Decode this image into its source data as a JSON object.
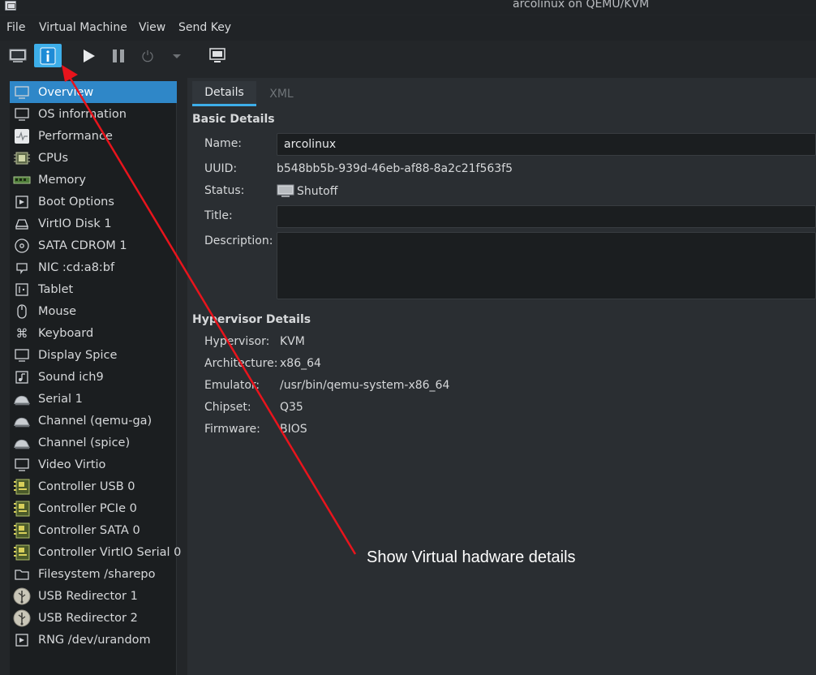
{
  "window": {
    "title": "arcolinux on QEMU/KVM"
  },
  "menu": [
    "File",
    "Virtual Machine",
    "View",
    "Send Key"
  ],
  "toolbar": [
    {
      "name": "console",
      "icon": "monitor-icon",
      "active": false
    },
    {
      "name": "details",
      "icon": "info-icon",
      "active": true
    },
    {
      "name": "run",
      "icon": "play-icon",
      "active": false
    },
    {
      "name": "pause",
      "icon": "pause-icon",
      "active": false
    },
    {
      "name": "shutdown",
      "icon": "power-icon",
      "active": false,
      "disabled": true
    },
    {
      "name": "shutdown-menu",
      "icon": "chevron-down-icon",
      "active": false,
      "disabled": true
    },
    {
      "name": "fullscreen",
      "icon": "fullscreen-icon",
      "active": false
    }
  ],
  "sidebar": {
    "items": [
      {
        "label": "Overview",
        "icon": "display-icon",
        "selected": true
      },
      {
        "label": "OS information",
        "icon": "display-icon"
      },
      {
        "label": "Performance",
        "icon": "performance-icon"
      },
      {
        "label": "CPUs",
        "icon": "cpu-icon"
      },
      {
        "label": "Memory",
        "icon": "memory-icon"
      },
      {
        "label": "Boot Options",
        "icon": "boot-icon"
      },
      {
        "label": "VirtIO Disk 1",
        "icon": "disk-icon"
      },
      {
        "label": "SATA CDROM 1",
        "icon": "cdrom-icon"
      },
      {
        "label": "NIC :cd:a8:bf",
        "icon": "nic-icon"
      },
      {
        "label": "Tablet",
        "icon": "tablet-icon"
      },
      {
        "label": "Mouse",
        "icon": "mouse-icon"
      },
      {
        "label": "Keyboard",
        "icon": "keyboard-icon"
      },
      {
        "label": "Display Spice",
        "icon": "display-icon"
      },
      {
        "label": "Sound ich9",
        "icon": "sound-icon"
      },
      {
        "label": "Serial 1",
        "icon": "serial-icon"
      },
      {
        "label": "Channel (qemu-ga)",
        "icon": "serial-icon"
      },
      {
        "label": "Channel (spice)",
        "icon": "serial-icon"
      },
      {
        "label": "Video Virtio",
        "icon": "display-icon"
      },
      {
        "label": "Controller USB 0",
        "icon": "controller-icon"
      },
      {
        "label": "Controller PCIe 0",
        "icon": "controller-icon"
      },
      {
        "label": "Controller SATA 0",
        "icon": "controller-icon"
      },
      {
        "label": "Controller VirtIO Serial 0",
        "icon": "controller-icon"
      },
      {
        "label": "Filesystem /sharepo",
        "icon": "folder-icon"
      },
      {
        "label": "USB Redirector 1",
        "icon": "usb-icon"
      },
      {
        "label": "USB Redirector 2",
        "icon": "usb-icon"
      },
      {
        "label": "RNG /dev/urandom",
        "icon": "rng-icon"
      }
    ]
  },
  "tabs": [
    {
      "label": "Details",
      "active": true
    },
    {
      "label": "XML",
      "active": false
    }
  ],
  "basic": {
    "title": "Basic Details",
    "name_label": "Name:",
    "name_value": "arcolinux",
    "uuid_label": "UUID:",
    "uuid_value": "b548bb5b-939d-46eb-af88-8a2c21f563f5",
    "status_label": "Status:",
    "status_value": "Shutoff",
    "status_icon": "monitor-icon",
    "title_label": "Title:",
    "title_value": "",
    "description_label": "Description:",
    "description_value": ""
  },
  "hypervisor": {
    "title": "Hypervisor Details",
    "rows": [
      {
        "label": "Hypervisor:",
        "value": "KVM"
      },
      {
        "label": "Architecture:",
        "value": "x86_64"
      },
      {
        "label": "Emulator:",
        "value": "/usr/bin/qemu-system-x86_64"
      },
      {
        "label": "Chipset:",
        "value": "Q35"
      },
      {
        "label": "Firmware:",
        "value": "BIOS"
      }
    ]
  },
  "annotation": {
    "text": "Show Virtual hadware details",
    "color": "#e8141c"
  },
  "colors": {
    "accent": "#3daee9",
    "selection": "#2f87c8",
    "background": "#232629",
    "panel": "#2a2e32"
  }
}
